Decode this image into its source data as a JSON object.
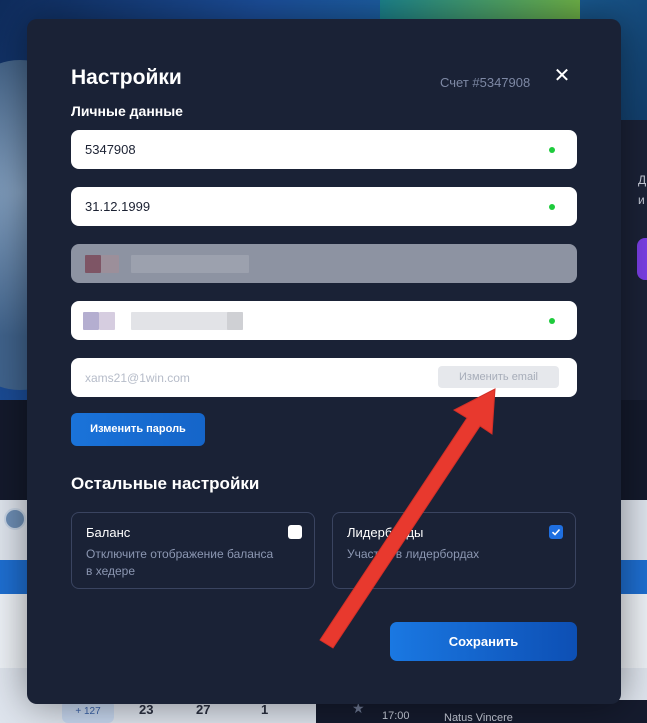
{
  "modal": {
    "title": "Настройки",
    "account_label": "Счет #5347908",
    "close_symbol": "✕"
  },
  "personal": {
    "section_title": "Личные данные",
    "fields": [
      {
        "value": "5347908",
        "verified": true
      },
      {
        "value": "31.12.1999",
        "verified": true
      },
      {
        "value": "",
        "verified": false,
        "disabled": true
      },
      {
        "value": "",
        "verified": true
      }
    ],
    "email_placeholder": "xams21@1win.com",
    "change_email_label": "Изменить email",
    "change_password_label": "Изменить пароль"
  },
  "other": {
    "section_title": "Остальные настройки",
    "balance": {
      "title": "Баланс",
      "description": "Отключите отображение баланса в хедере",
      "checked": false
    },
    "leaderboards": {
      "title": "Лидерборды",
      "description": "Участие в лидербордах",
      "checked": true
    }
  },
  "save_label": "Сохранить",
  "background": {
    "right_text_1": "Д",
    "right_text_2": "и",
    "pill": "+ 127",
    "nums": [
      "23",
      "27",
      "1"
    ],
    "time": "17:00",
    "team": "Natus Vincere"
  },
  "colors": {
    "modal_bg": "#1a2236",
    "accent_blue": "#1a73d9",
    "status_green": "#1ecb3c",
    "annotation_arrow": "#e8392e"
  }
}
